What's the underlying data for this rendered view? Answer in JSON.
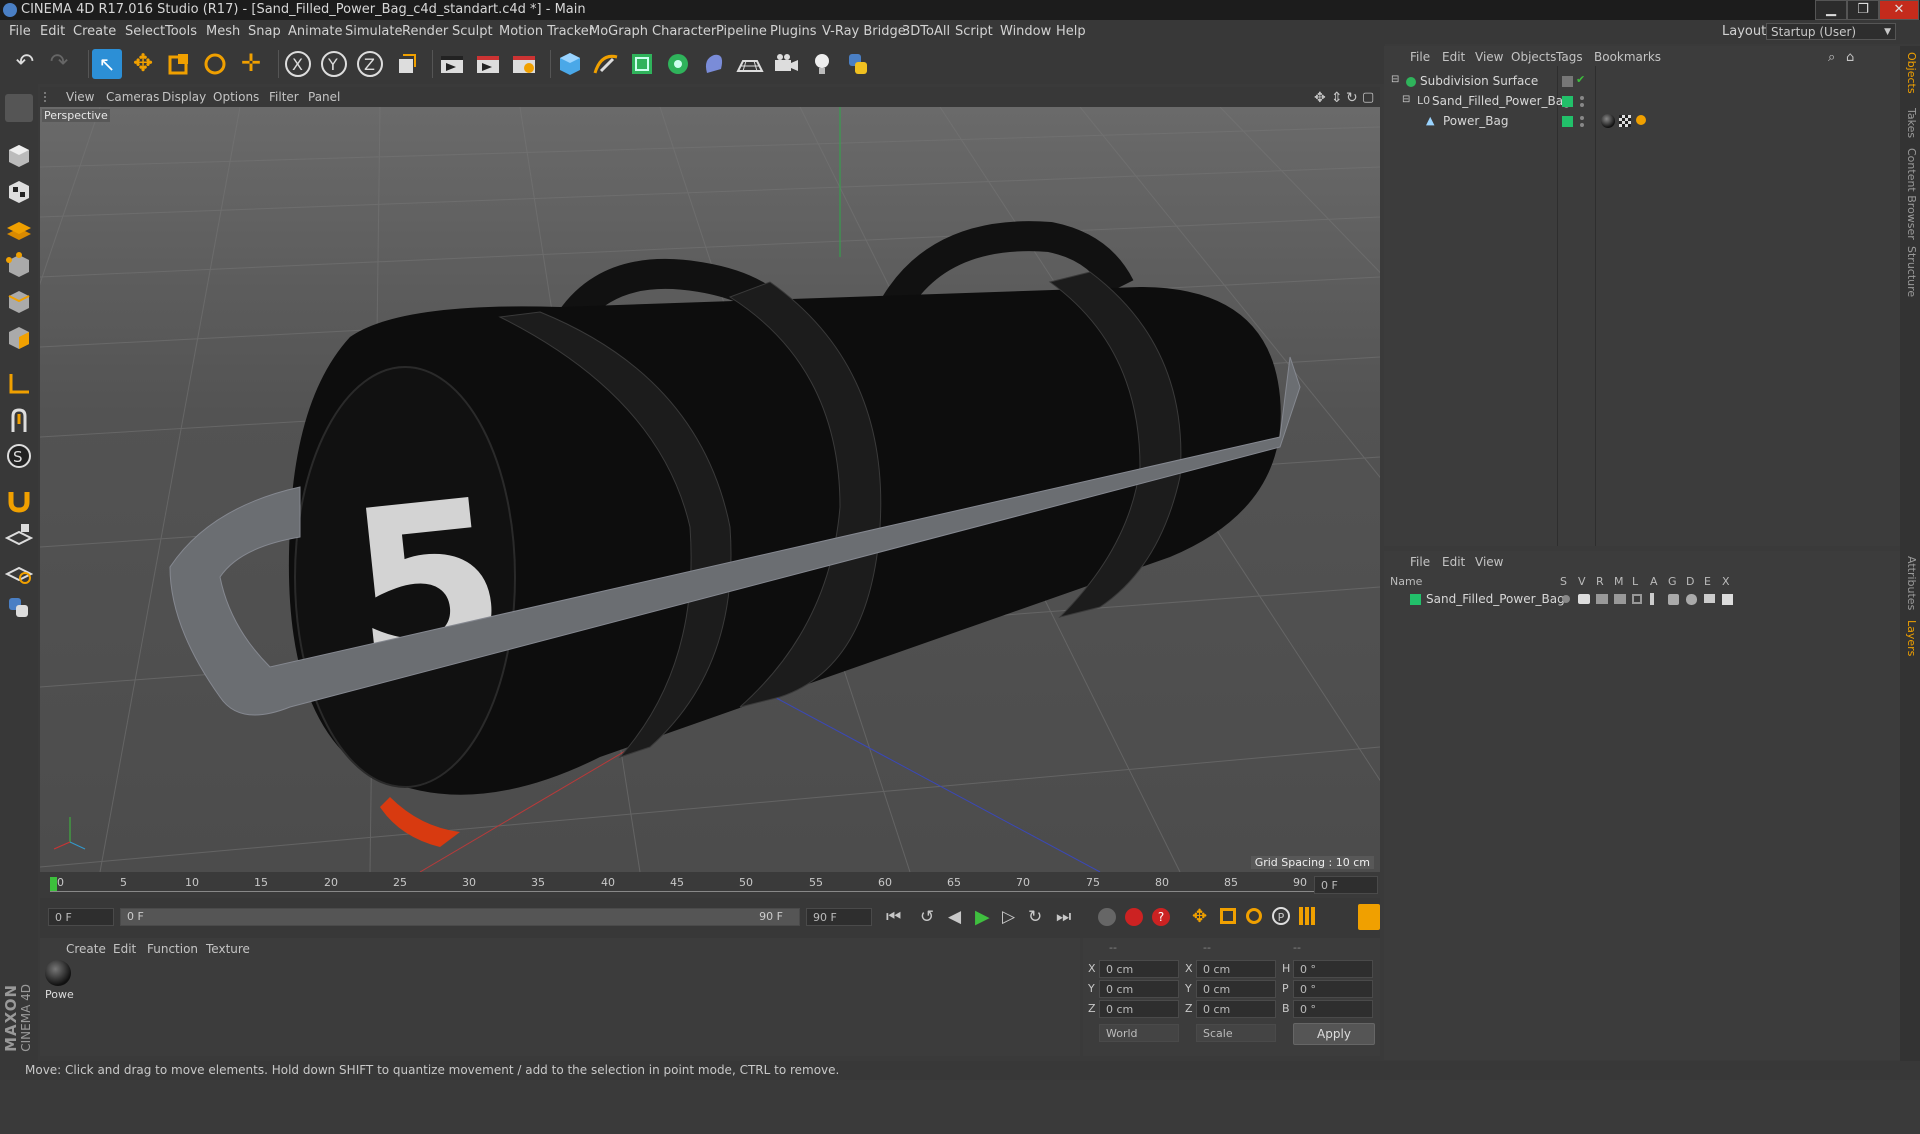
{
  "window": {
    "title": "CINEMA 4D R17.016 Studio (R17) - [Sand_Filled_Power_Bag_c4d_standart.c4d *] - Main"
  },
  "menubar": [
    "File",
    "Edit",
    "Create",
    "Select",
    "Tools",
    "Mesh",
    "Snap",
    "Animate",
    "Simulate",
    "Render",
    "Sculpt",
    "Motion Tracker",
    "MoGraph",
    "Character",
    "Pipeline",
    "Plugins",
    "V-Ray Bridge",
    "3DToAll",
    "Script",
    "Window",
    "Help"
  ],
  "layout": {
    "label": "Layout:",
    "value": "Startup (User)"
  },
  "viewport": {
    "menu": [
      "View",
      "Cameras",
      "Display",
      "Options",
      "Filter",
      "Panel"
    ],
    "camera_label": "Perspective",
    "grid_spacing": "Grid Spacing : 10 cm",
    "bag_number": "5"
  },
  "timeline": {
    "ticks": [
      "0",
      "5",
      "10",
      "15",
      "20",
      "25",
      "30",
      "35",
      "40",
      "45",
      "50",
      "55",
      "60",
      "65",
      "70",
      "75",
      "80",
      "85",
      "90"
    ],
    "current_frame": "0 F",
    "start_field": "0 F",
    "range_start": "0 F",
    "range_end": "90 F",
    "end_field": "90 F"
  },
  "material_panel": {
    "menu": [
      "Create",
      "Edit",
      "Function",
      "Texture"
    ],
    "material_name": "Powe"
  },
  "coords": {
    "header": [
      "--",
      "--",
      "--"
    ],
    "rows": [
      {
        "a": "X",
        "av": "0 cm",
        "b": "X",
        "bv": "0 cm",
        "c": "H",
        "cv": "0 °"
      },
      {
        "a": "Y",
        "av": "0 cm",
        "b": "Y",
        "bv": "0 cm",
        "c": "P",
        "cv": "0 °"
      },
      {
        "a": "Z",
        "av": "0 cm",
        "b": "Z",
        "bv": "0 cm",
        "c": "B",
        "cv": "0 °"
      }
    ],
    "space": "World",
    "mode": "Scale",
    "apply": "Apply"
  },
  "object_manager": {
    "menu": [
      "File",
      "Edit",
      "View",
      "Objects",
      "Tags",
      "Bookmarks"
    ],
    "objects": [
      "Subdivision Surface",
      "Sand_Filled_Power_Bag",
      "Power_Bag"
    ]
  },
  "layer_manager": {
    "menu": [
      "File",
      "Edit",
      "View"
    ],
    "columns": [
      "Name",
      "S",
      "V",
      "R",
      "M",
      "L",
      "A",
      "G",
      "D",
      "E",
      "X"
    ],
    "layers": [
      "Sand_Filled_Power_Bag"
    ]
  },
  "right_tabs": [
    "Objects",
    "Takes",
    "Content Browser",
    "Structure",
    "Attributes",
    "Layers"
  ],
  "status": "Move: Click and drag to move elements. Hold down SHIFT to quantize movement / add to the selection in point mode, CTRL to remove.",
  "brand": {
    "maxon": "MAXON",
    "product": "CINEMA 4D"
  },
  "colors": {
    "accent": "#2c8fd6",
    "layer_green": "#22c06a",
    "play_green": "#3fbf3f",
    "record_red": "#cc2222",
    "bag": "#0d0d0d",
    "strap": "#6b6e72"
  }
}
